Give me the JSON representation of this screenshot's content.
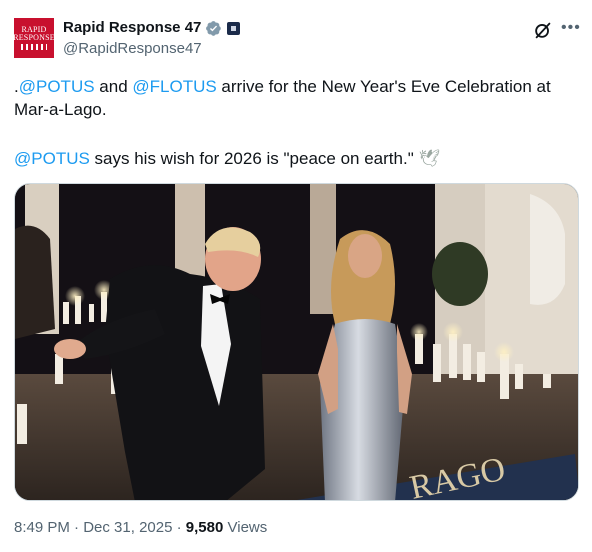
{
  "account": {
    "avatar_text_line1": "RAPID",
    "avatar_text_line2": "RESPONSE",
    "display_name": "Rapid Response 47",
    "handle": "@RapidResponse47"
  },
  "tweet": {
    "line1_prefix": ".",
    "mention_potus": "@POTUS",
    "line1_and": " and ",
    "mention_flotus": "@FLOTUS",
    "line1_rest": " arrive for the New Year's Eve Celebration at Mar-a-Lago.",
    "line2_mention": "@POTUS",
    "line2_rest": " says his wish for 2026 is \"peace on earth.\"",
    "line2_emoji": "🕊"
  },
  "media": {
    "floor_text": "RAGO"
  },
  "meta": {
    "time": "8:49 PM",
    "sep1": " · ",
    "date": "Dec 31, 2025",
    "sep2": " · ",
    "views_count": "9,580",
    "views_label": " Views"
  },
  "colors": {
    "link": "#1d9bf0",
    "secondary": "#536471",
    "brand_red": "#c8102e",
    "verified": "#829aab"
  },
  "icons": [
    "verified-badge-icon",
    "affiliate-badge-icon",
    "grok-icon",
    "more-icon",
    "dove-emoji"
  ]
}
